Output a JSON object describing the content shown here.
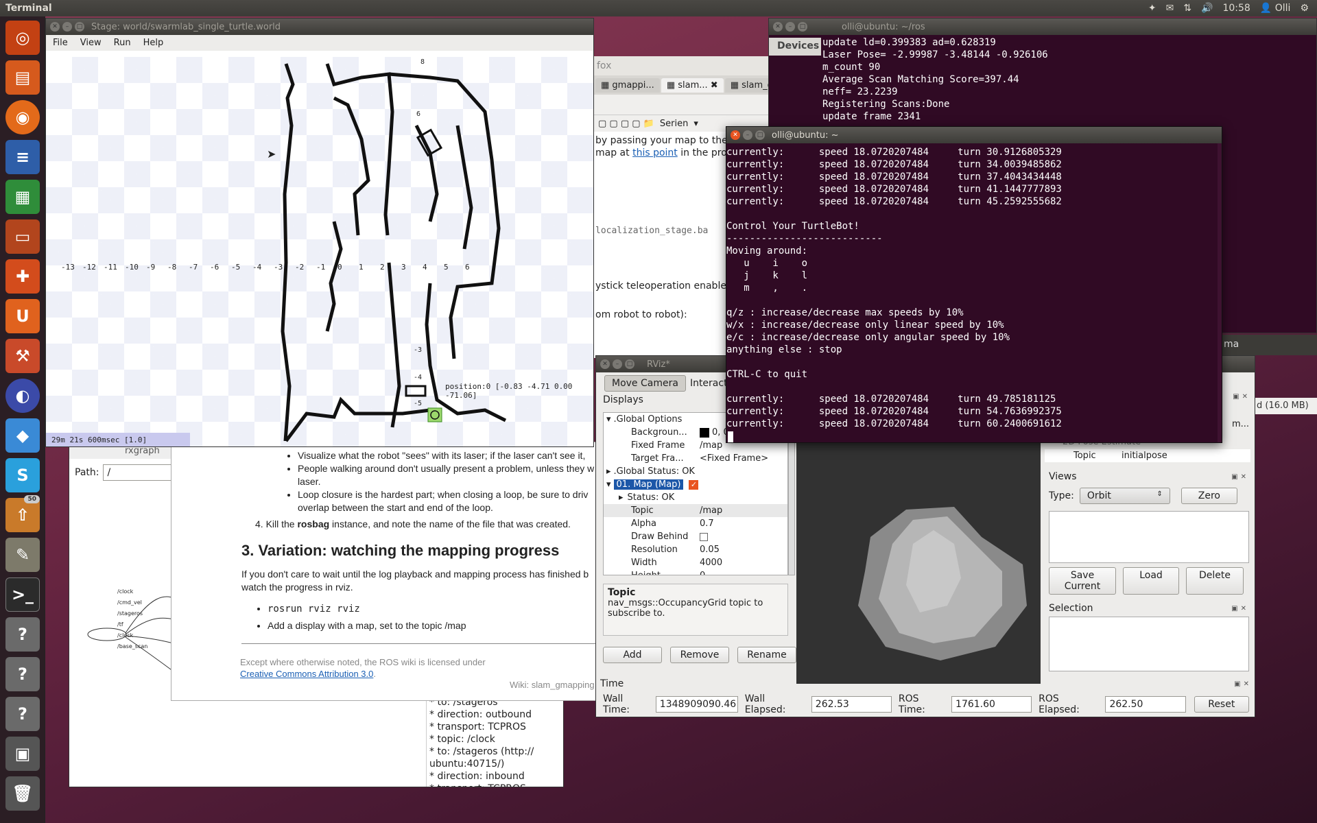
{
  "topbar": {
    "app_name": "Terminal",
    "time": "10:58",
    "user": "Olli"
  },
  "launcher": {
    "update_badge": "50"
  },
  "rxgraph": {
    "title": "rxgraph",
    "path_label": "Path:",
    "path_value": "/",
    "graph_nodes": [
      "/clock",
      "/cmd_vel",
      "/stageros",
      "/tf",
      "/clock",
      "/base_scan"
    ],
    "info_lines": [
      "* to: /stageros",
      "* direction: outbound",
      "* transport: TCPROS",
      "* topic: /clock",
      "* to: /stageros (http://",
      "ubuntu:40715/)",
      "* direction: inbound",
      "* transport: TCPROS"
    ]
  },
  "browser": {
    "title_fragment": "fox",
    "tabs": [
      "gmappi...",
      "slam...",
      "slam_g..."
    ],
    "bookmark": "Serien",
    "partial_lines": [
      "by passing your map to the",
      "map at",
      "this point",
      "in the process",
      "localization_stage.ba",
      "ystick teleoperation enabled (d",
      "om robot to robot):"
    ],
    "link_fragment": "m"
  },
  "wiki": {
    "bullets": [
      "Visualize what the robot \"sees\" with its laser; if the laser can't see it,",
      "People walking around don't usually present a problem, unless they w",
      "laser.",
      "Loop closure is the hardest part; when closing a loop, be sure to driv",
      "overlap between the start and end of the loop."
    ],
    "step4_pre": "4.  Kill the ",
    "step4_bold": "rosbag",
    "step4_post": " instance, and note the name of the file that was created.",
    "heading": "3. Variation: watching the mapping progress",
    "para1": "If you don't care to wait until the log playback and mapping process has finished b",
    "para2": "watch the progress in rviz.",
    "cmd": "rosrun rviz rviz",
    "bullet2": "Add a display with a map, set to the topic /map",
    "footer1": "Except where otherwise noted, the ROS wiki is licensed under",
    "footer_link": "Creative Commons Attribution 3.0",
    "footer_dot": ".",
    "footer_right": "Wiki: slam_gmapping"
  },
  "stage": {
    "title": "Stage: world/swarmlab_single_turtle.world",
    "menu": [
      "File",
      "View",
      "Run",
      "Help"
    ],
    "x_ticks": [
      "-13",
      "-12",
      "-11",
      "-10",
      "-9",
      "-8",
      "-7",
      "-6",
      "-5",
      "-4",
      "-3",
      "-2",
      "-1",
      "0",
      "1",
      "2",
      "3",
      "4",
      "5",
      "6"
    ],
    "y_ticks": [
      "8",
      "6",
      "-3",
      "-4",
      "-5"
    ],
    "pose_label": "position:0 [-0.83 -4.71 0.00 -71.06]",
    "status": "29m 21s 600msec [1.0]"
  },
  "terminal_ros": {
    "title": "olli@ubuntu: ~/ros",
    "devices_tab": "Devices",
    "lines": [
      "update ld=0.399383 ad=0.628319",
      "Laser Pose= -2.99987 -3.48144 -0.926106",
      "m_count 90",
      "Average Scan Matching Score=397.44",
      "neff= 23.2239",
      "Registering Scans:Done",
      "update frame 2341"
    ]
  },
  "terminal_main": {
    "title": "olli@ubuntu: ~",
    "lines": [
      "currently:      speed 18.0720207484     turn 30.9126805329",
      "currently:      speed 18.0720207484     turn 34.0039485862",
      "currently:      speed 18.0720207484     turn 37.4043434448",
      "currently:      speed 18.0720207484     turn 41.1447777893",
      "currently:      speed 18.0720207484     turn 45.2592555682",
      "",
      "Control Your TurtleBot!",
      "---------------------------",
      "Moving around:",
      "   u    i    o",
      "   j    k    l",
      "   m    ,    .",
      "",
      "q/z : increase/decrease max speeds by 10%",
      "w/x : increase/decrease only linear speed by 10%",
      "e/c : increase/decrease only angular speed by 10%",
      "anything else : stop",
      "",
      "CTRL-C to quit",
      "",
      "currently:      speed 18.0720207484     turn 49.785181125",
      "currently:      speed 18.0720207484     turn 54.7636992375",
      "currently:      speed 18.0720207484     turn 60.2400691612"
    ]
  },
  "rviz": {
    "title": "RViz*",
    "tools": {
      "move_camera": "Move Camera",
      "interact": "Interact",
      "more": "S"
    },
    "displays_title": "Displays",
    "global_options": ".Global Options",
    "background_label": "Backgroun...",
    "background_value": "0, 0,",
    "fixed_frame_label": "Fixed Frame",
    "fixed_frame_value": "/map",
    "target_frame_label": "Target Fra...",
    "target_frame_value": "<Fixed Frame>",
    "global_status": ".Global Status: OK",
    "map_display": "01. Map (Map)",
    "status_ok": "Status: OK",
    "props": [
      {
        "k": "Topic",
        "v": "/map"
      },
      {
        "k": "Alpha",
        "v": "0.7"
      },
      {
        "k": "Draw Behind",
        "v": ""
      },
      {
        "k": "Resolution",
        "v": "0.05"
      },
      {
        "k": "Width",
        "v": "4000"
      },
      {
        "k": "Height",
        "v": "0"
      }
    ],
    "help_title": "Topic",
    "help_text": "nav_msgs::OccupancyGrid topic to subscribe to.",
    "add_btn": "Add",
    "remove_btn": "Remove",
    "rename_btn": "Rename",
    "tool_prop_trunc": "m...",
    "pose_estimate": "2D Pose Estimate",
    "pose_topic_label": "Topic",
    "pose_topic_value": "initialpose",
    "views_title": "Views",
    "type_label": "Type:",
    "type_value": "Orbit",
    "zero_btn": "Zero",
    "save_current_btn": "Save Current",
    "load_btn": "Load",
    "delete_btn": "Delete",
    "selection_title": "Selection",
    "time_title": "Time",
    "wall_time_label": "Wall Time:",
    "wall_time": "1348909090.46",
    "wall_elapsed_label": "Wall Elapsed:",
    "wall_elapsed": "262.53",
    "ros_time_label": "ROS Time:",
    "ros_time": "1761.60",
    "ros_elapsed_label": "ROS Elapsed:",
    "ros_elapsed": "262.50",
    "reset_btn": "Reset"
  },
  "background_window": {
    "size_label": "d (16.0 MB)",
    "title_fragment": "ma"
  },
  "colors": {
    "ubuntu_orange": "#e95420",
    "terminal_bg": "#300a24",
    "window_title": "#3c3b37",
    "selection_blue": "#1c57a8"
  }
}
